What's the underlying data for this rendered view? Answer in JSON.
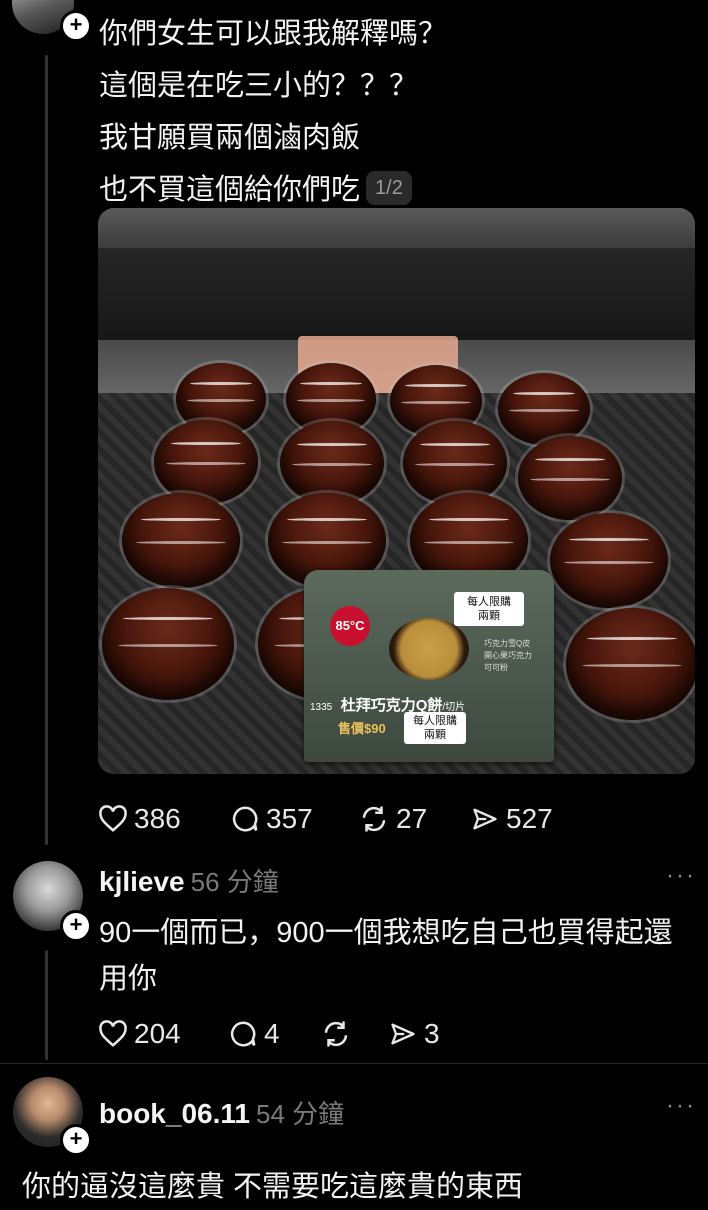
{
  "post": {
    "lines": [
      "你們女生可以跟我解釋嗎？",
      "這個是在吃三小的？？？",
      "我甘願買兩個滷肉飯",
      "也不買這個給你們吃"
    ],
    "pager": "1/2",
    "image": {
      "sign_logo": "85°C",
      "sign_top_badge": [
        "每人限購",
        "兩顆"
      ],
      "sign_notes": [
        "巧克力雪Q皮",
        "開心果巧克力",
        "可可粉"
      ],
      "sign_code": "1335",
      "sign_product": "杜拜巧克力Q餅",
      "sign_product_suffix": "/切片",
      "sign_price": "售價$90",
      "sign_bottom_badge": [
        "每人限購",
        "兩顆"
      ]
    },
    "stats": {
      "likes": "386",
      "comments": "357",
      "reposts": "27",
      "shares": "527"
    }
  },
  "replies": [
    {
      "username": "kjlieve",
      "time": "56 分鐘",
      "text": "90一個而已，900一個我想吃自己也買得起還用你",
      "stats": {
        "likes": "204",
        "comments": "4",
        "shares": "3"
      }
    },
    {
      "username": "book_06.11",
      "time": "54 分鐘",
      "text": "你的逼沒這麼貴 不需要吃這麼貴的東西"
    }
  ],
  "colors": {
    "background": "#000000",
    "text": "#f2f2f2",
    "muted": "#7a7a7a",
    "thread_line": "#333333"
  }
}
